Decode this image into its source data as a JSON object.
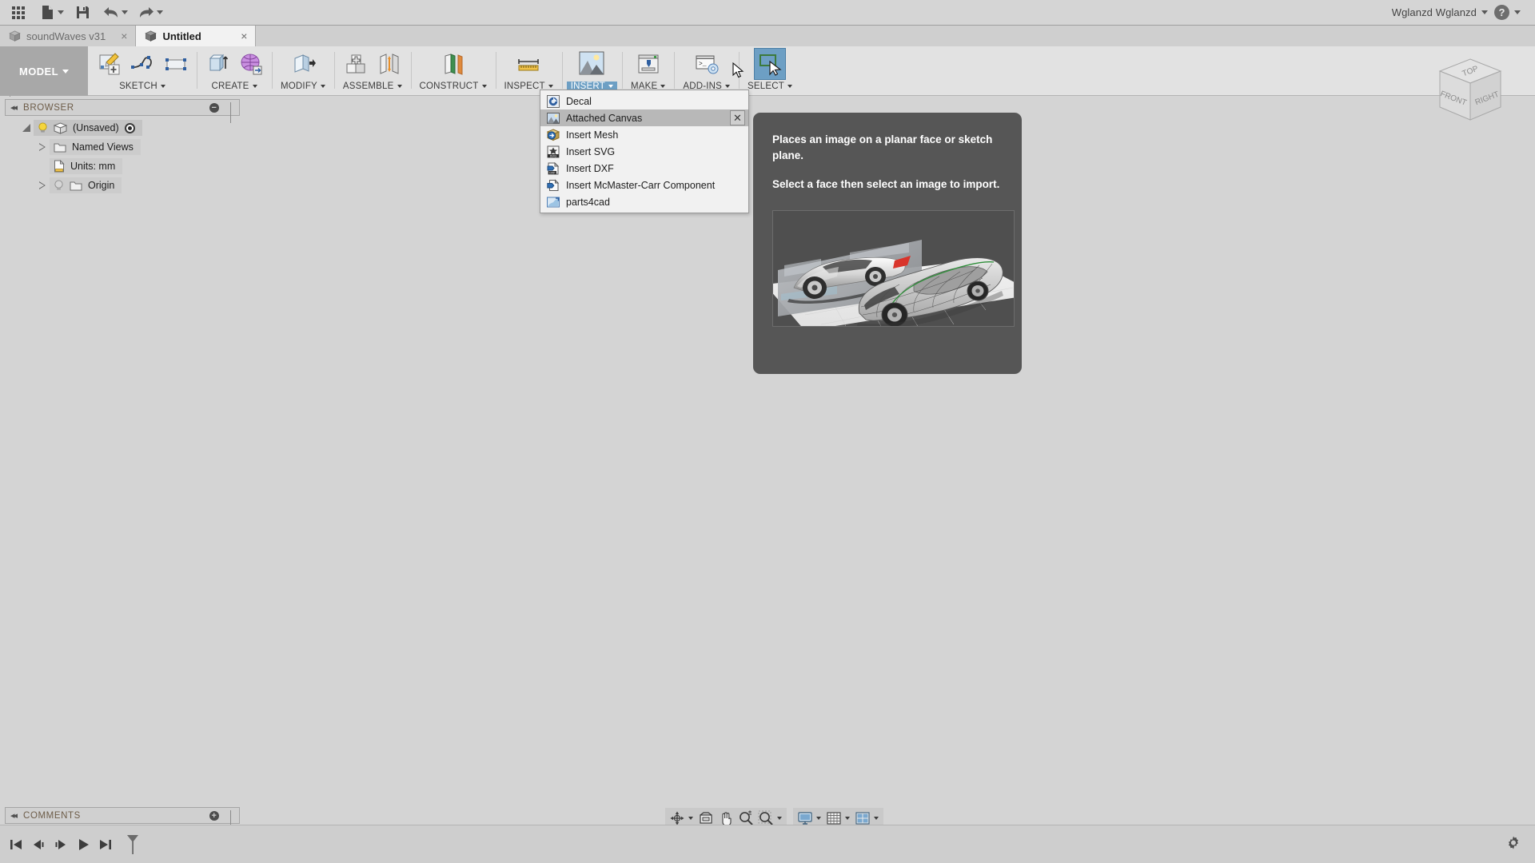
{
  "appbar": {
    "buttons": [
      {
        "name": "app-grid-button",
        "icon": "grid-icon",
        "label": "Show Data Panel"
      },
      {
        "name": "file-button",
        "icon": "file-icon",
        "label": "File"
      },
      {
        "name": "save-button",
        "icon": "save-icon",
        "label": "Save"
      },
      {
        "name": "undo-button",
        "icon": "undo-arrow-icon",
        "label": "Undo"
      },
      {
        "name": "redo-button",
        "icon": "redo-arrow-icon",
        "label": "Redo"
      }
    ],
    "user_name": "Wglanzd Wglanzd",
    "help_glyph": "?"
  },
  "tabs": [
    {
      "label": "soundWaves v31",
      "active": false,
      "close_glyph": "×"
    },
    {
      "label": "Untitled",
      "active": true,
      "close_glyph": "×"
    }
  ],
  "ribbon": {
    "workspace": "MODEL",
    "groups": [
      {
        "label": "SKETCH",
        "icons": [
          "create-sketch-icon",
          "spline-icon",
          "rectangle-icon"
        ],
        "highlighted": false
      },
      {
        "label": "CREATE",
        "icons": [
          "extrude-icon",
          "create-form-icon"
        ],
        "highlighted": false
      },
      {
        "label": "MODIFY",
        "icons": [
          "press-pull-icon"
        ],
        "highlighted": false
      },
      {
        "label": "ASSEMBLE",
        "icons": [
          "new-component-icon",
          "joint-icon"
        ],
        "highlighted": false
      },
      {
        "label": "CONSTRUCT",
        "icons": [
          "offset-plane-icon"
        ],
        "highlighted": false
      },
      {
        "label": "INSPECT",
        "icons": [
          "measure-ruler-icon"
        ],
        "highlighted": false
      },
      {
        "label": "INSERT",
        "icons": [
          "insert-image-icon"
        ],
        "highlighted": true
      },
      {
        "label": "MAKE",
        "icons": [
          "3d-print-icon"
        ],
        "highlighted": false
      },
      {
        "label": "ADD-INS",
        "icons": [
          "script-addin-icon"
        ],
        "highlighted": false
      },
      {
        "label": "SELECT",
        "icons": [
          "select-cursor-icon"
        ],
        "highlighted": false,
        "icon_selected": true
      }
    ]
  },
  "insert_menu": {
    "items": [
      {
        "label": "Decal",
        "icon": "decal-icon",
        "highlighted": false,
        "has_close": false
      },
      {
        "label": "Attached Canvas",
        "icon": "attached-canvas-icon",
        "highlighted": true,
        "has_close": true,
        "close_glyph": "✕"
      },
      {
        "label": "Insert Mesh",
        "icon": "insert-mesh-icon",
        "highlighted": false,
        "has_close": false
      },
      {
        "label": "Insert SVG",
        "icon": "insert-svg-icon",
        "highlighted": false,
        "has_close": false
      },
      {
        "label": "Insert DXF",
        "icon": "insert-dxf-icon",
        "highlighted": false,
        "has_close": false
      },
      {
        "label": "Insert McMaster-Carr Component",
        "icon": "insert-mcmaster-icon",
        "highlighted": false,
        "has_close": false
      },
      {
        "label": "parts4cad",
        "icon": "parts4cad-icon",
        "highlighted": false,
        "has_close": false
      }
    ]
  },
  "tooltip": {
    "line1": "Places an image on a planar face or sketch plane.",
    "line2": "Select a face then select an image to import.",
    "image_name": "attached-canvas-preview-car-sketch"
  },
  "browser": {
    "title": "BROWSER",
    "collapse_glyph": "◂◂",
    "dot_glyph": "−",
    "nodes": [
      {
        "label": "(Unsaved)",
        "indent": 0,
        "twisty": "expanded",
        "icons": [
          "lightbulb-on-icon",
          "component-cube-icon"
        ],
        "trailing_icon": "activate-radio-icon"
      },
      {
        "label": "Named Views",
        "indent": 1,
        "twisty": "collapsed",
        "icons": [
          "folder-icon"
        ],
        "trailing_icon": ""
      },
      {
        "label": "Units: mm",
        "indent": 1,
        "twisty": "none",
        "icons": [
          "units-doc-icon"
        ],
        "trailing_icon": ""
      },
      {
        "label": "Origin",
        "indent": 1,
        "twisty": "collapsed",
        "icons": [
          "lightbulb-off-icon",
          "folder-icon"
        ],
        "trailing_icon": ""
      }
    ]
  },
  "viewcube": {
    "faces": [
      "TOP",
      "FRONT",
      "RIGHT"
    ]
  },
  "comments": {
    "title": "COMMENTS",
    "collapse_glyph": "◂◂",
    "dot_glyph": "+"
  },
  "timeline": {
    "buttons": [
      {
        "name": "timeline-jump-start",
        "icon": "skip-to-start-icon"
      },
      {
        "name": "timeline-step-back",
        "icon": "step-back-icon"
      },
      {
        "name": "timeline-step-forward",
        "icon": "step-forward-icon"
      },
      {
        "name": "timeline-play",
        "icon": "play-icon"
      },
      {
        "name": "timeline-jump-end",
        "icon": "skip-to-end-icon"
      },
      {
        "name": "timeline-marker",
        "icon": "timeline-marker-icon"
      }
    ],
    "settings_icon": "gear-icon"
  },
  "view_tools": {
    "group1": [
      {
        "name": "orbit-button",
        "icon": "orbit-icon",
        "has_caret": true
      },
      {
        "name": "look-at-button",
        "icon": "look-at-icon",
        "has_caret": false
      },
      {
        "name": "pan-button",
        "icon": "pan-hand-icon",
        "has_caret": false
      },
      {
        "name": "zoom-button",
        "icon": "zoom-magnifier-icon",
        "has_caret": false
      },
      {
        "name": "fit-button",
        "icon": "zoom-window-icon",
        "has_caret": true
      }
    ],
    "group2": [
      {
        "name": "display-settings-button",
        "icon": "display-monitor-icon",
        "has_caret": true
      },
      {
        "name": "grid-snaps-button",
        "icon": "grid-icon",
        "has_caret": true
      },
      {
        "name": "viewports-button",
        "icon": "viewports-icon",
        "has_caret": true
      }
    ]
  },
  "colors": {
    "accent_blue": "#6d9fc4",
    "ribbon_bg": "#e2e2e2",
    "canvas_bg": "#d4d4d4",
    "tooltip_bg": "#565656",
    "panel_header": "#d0d0d0",
    "header_text": "#6d5c48"
  }
}
